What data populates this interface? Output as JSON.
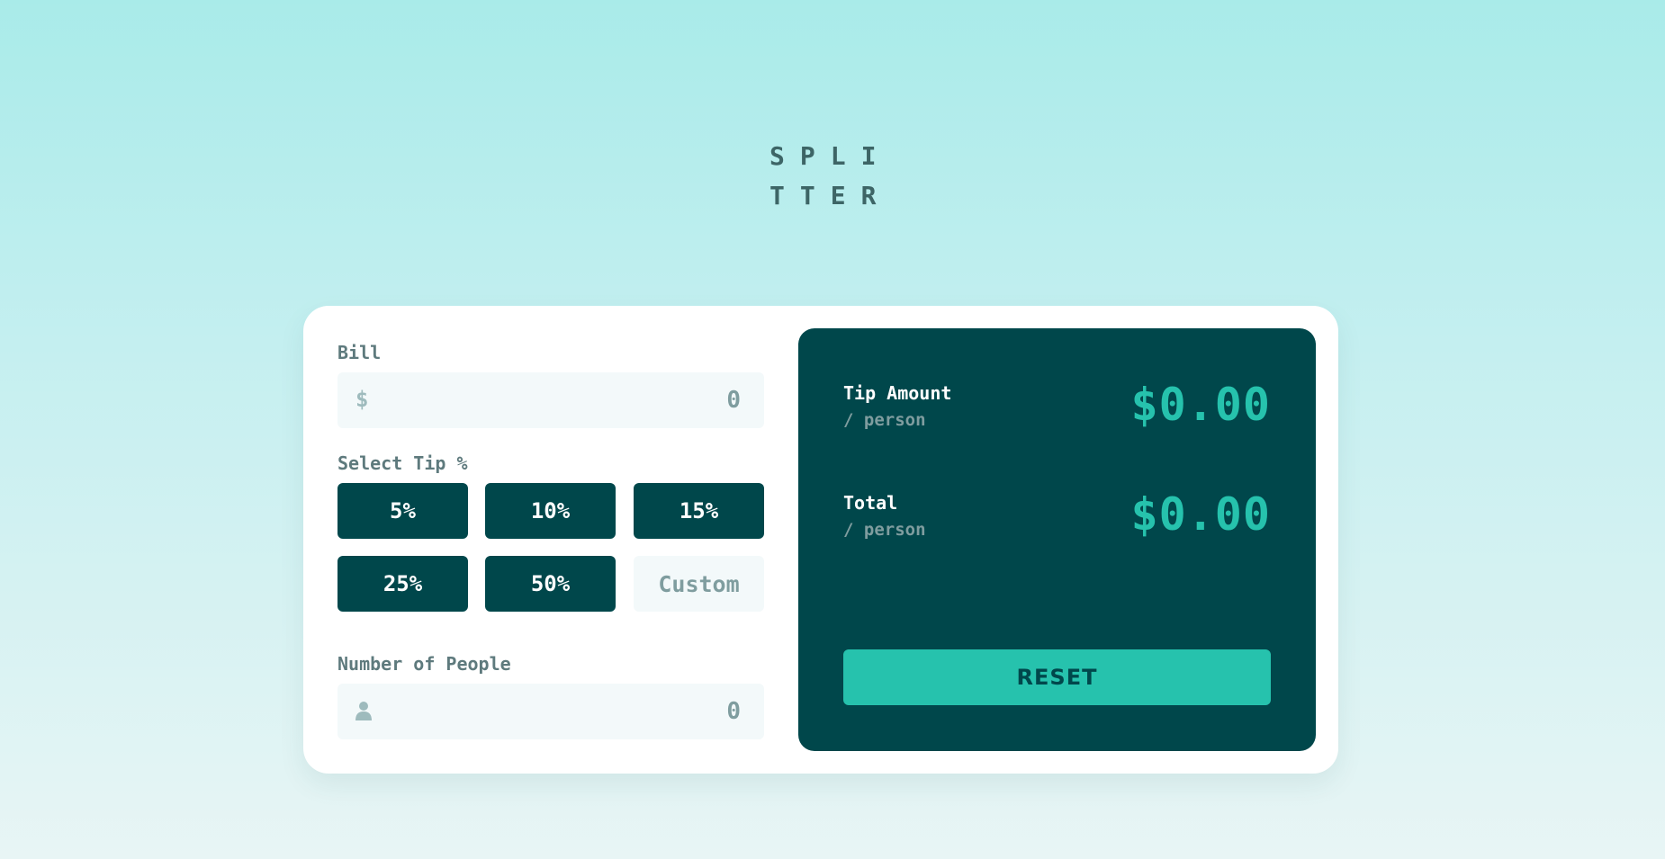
{
  "logo": {
    "line1": "SPLI",
    "line2": "TTER"
  },
  "bill": {
    "label": "Bill",
    "prefix": "$",
    "value": "0"
  },
  "tip": {
    "label": "Select Tip %",
    "options": [
      "5%",
      "10%",
      "15%",
      "25%",
      "50%"
    ],
    "custom_placeholder": "Custom"
  },
  "people": {
    "label": "Number of People",
    "value": "0",
    "icon": "person-icon"
  },
  "results": {
    "tip_amount": {
      "title": "Tip Amount",
      "sub": "/ person",
      "value": "$0.00"
    },
    "total": {
      "title": "Total",
      "sub": "/ person",
      "value": "$0.00"
    },
    "reset_label": "RESET"
  },
  "colors": {
    "primary_dark": "#00474b",
    "accent": "#26c2ad",
    "input_bg": "#f3f9fa",
    "label": "#5e7a7d"
  }
}
